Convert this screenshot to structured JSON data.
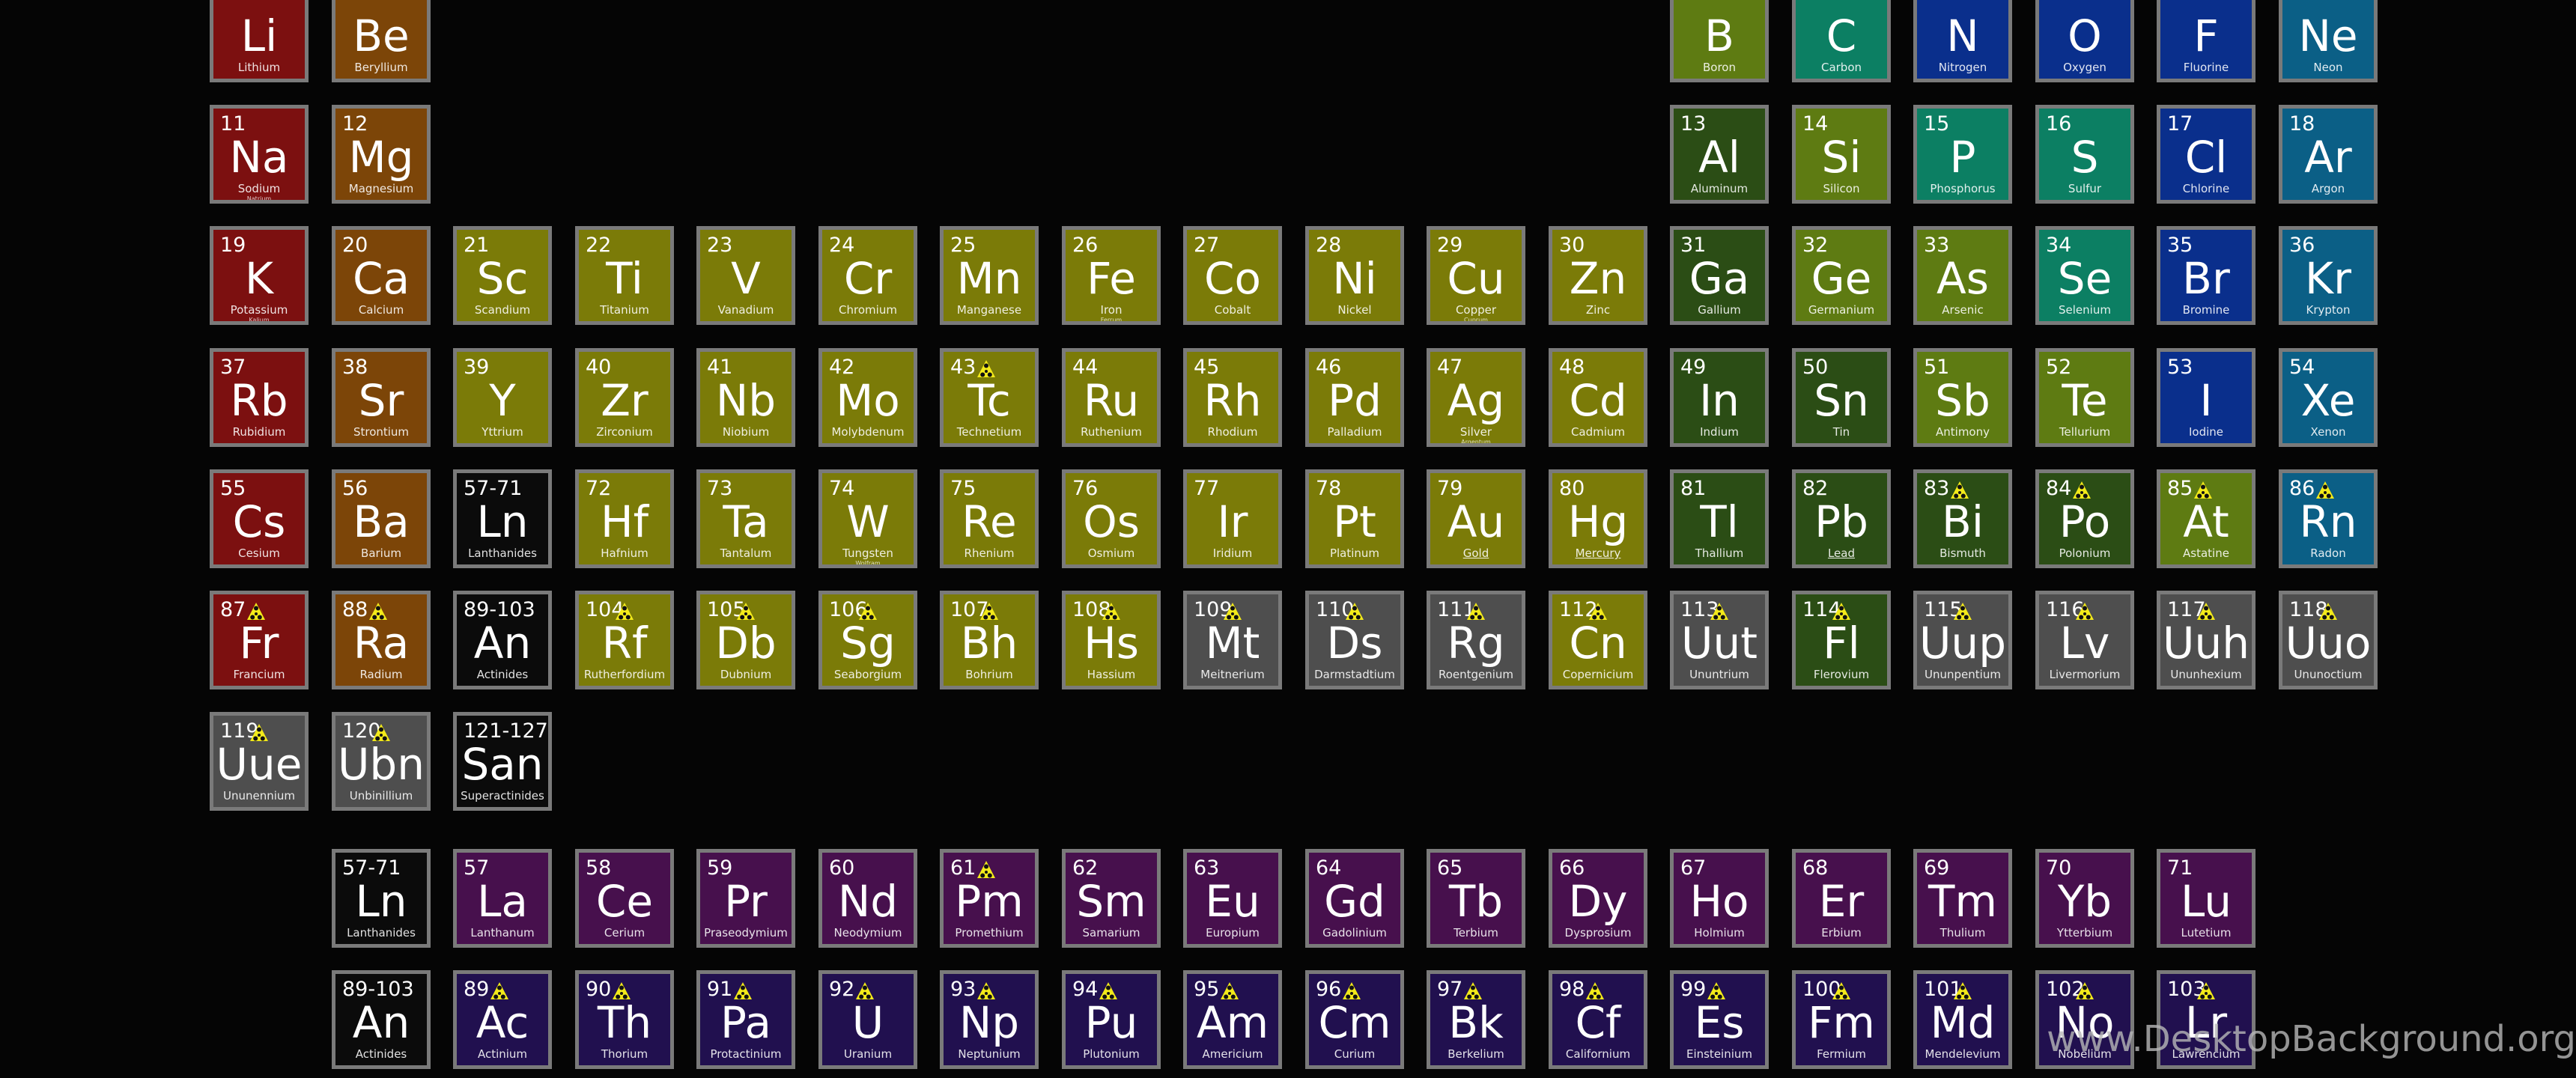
{
  "watermark": "www.DesktopBackground.org",
  "colors": {
    "alkali": "#7c1010",
    "alkaline": "#7c4508",
    "transition": "#7b7b08",
    "post": "#2b4d15",
    "metalloid": "#5e7b12",
    "nonmetal": "#0c7f63",
    "halogen": "#0a2f8c",
    "noble": "#0b5f86",
    "unknown": "#4e4e4e",
    "group": "#0b0b0b",
    "lanthanide": "#47104d",
    "actinide": "#21104f",
    "radioactive_icon": "#f3ea1a"
  },
  "main_table": [
    {
      "n": "",
      "s": "Li",
      "name": "Lithium",
      "cat": "alkali",
      "row": 0,
      "col": 0
    },
    {
      "n": "",
      "s": "Be",
      "name": "Beryllium",
      "cat": "alkaline",
      "row": 0,
      "col": 1
    },
    {
      "n": "",
      "s": "B",
      "name": "Boron",
      "cat": "metalloid",
      "row": 0,
      "col": 12
    },
    {
      "n": "",
      "s": "C",
      "name": "Carbon",
      "cat": "nonmetal",
      "row": 0,
      "col": 13
    },
    {
      "n": "",
      "s": "N",
      "name": "Nitrogen",
      "cat": "halogen",
      "row": 0,
      "col": 14
    },
    {
      "n": "",
      "s": "O",
      "name": "Oxygen",
      "cat": "halogen",
      "row": 0,
      "col": 15
    },
    {
      "n": "",
      "s": "F",
      "name": "Fluorine",
      "cat": "halogen",
      "row": 0,
      "col": 16
    },
    {
      "n": "",
      "s": "Ne",
      "name": "Neon",
      "cat": "noble",
      "row": 0,
      "col": 17
    },
    {
      "n": "11",
      "s": "Na",
      "name": "Sodium",
      "alt": "Natrium",
      "cat": "alkali",
      "row": 1,
      "col": 0
    },
    {
      "n": "12",
      "s": "Mg",
      "name": "Magnesium",
      "cat": "alkaline",
      "row": 1,
      "col": 1
    },
    {
      "n": "13",
      "s": "Al",
      "name": "Aluminum",
      "cat": "post",
      "row": 1,
      "col": 12
    },
    {
      "n": "14",
      "s": "Si",
      "name": "Silicon",
      "cat": "metalloid",
      "row": 1,
      "col": 13
    },
    {
      "n": "15",
      "s": "P",
      "name": "Phosphorus",
      "cat": "nonmetal",
      "row": 1,
      "col": 14
    },
    {
      "n": "16",
      "s": "S",
      "name": "Sulfur",
      "cat": "nonmetal",
      "row": 1,
      "col": 15
    },
    {
      "n": "17",
      "s": "Cl",
      "name": "Chlorine",
      "cat": "halogen",
      "row": 1,
      "col": 16
    },
    {
      "n": "18",
      "s": "Ar",
      "name": "Argon",
      "cat": "noble",
      "row": 1,
      "col": 17
    },
    {
      "n": "19",
      "s": "K",
      "name": "Potassium",
      "alt": "Kalium",
      "cat": "alkali",
      "row": 2,
      "col": 0
    },
    {
      "n": "20",
      "s": "Ca",
      "name": "Calcium",
      "cat": "alkaline",
      "row": 2,
      "col": 1
    },
    {
      "n": "21",
      "s": "Sc",
      "name": "Scandium",
      "cat": "transition",
      "row": 2,
      "col": 2
    },
    {
      "n": "22",
      "s": "Ti",
      "name": "Titanium",
      "cat": "transition",
      "row": 2,
      "col": 3
    },
    {
      "n": "23",
      "s": "V",
      "name": "Vanadium",
      "cat": "transition",
      "row": 2,
      "col": 4
    },
    {
      "n": "24",
      "s": "Cr",
      "name": "Chromium",
      "cat": "transition",
      "row": 2,
      "col": 5
    },
    {
      "n": "25",
      "s": "Mn",
      "name": "Manganese",
      "cat": "transition",
      "row": 2,
      "col": 6
    },
    {
      "n": "26",
      "s": "Fe",
      "name": "Iron",
      "alt": "Ferrum",
      "cat": "transition",
      "row": 2,
      "col": 7
    },
    {
      "n": "27",
      "s": "Co",
      "name": "Cobalt",
      "cat": "transition",
      "row": 2,
      "col": 8
    },
    {
      "n": "28",
      "s": "Ni",
      "name": "Nickel",
      "cat": "transition",
      "row": 2,
      "col": 9
    },
    {
      "n": "29",
      "s": "Cu",
      "name": "Copper",
      "alt": "Cuprum",
      "cat": "transition",
      "row": 2,
      "col": 10
    },
    {
      "n": "30",
      "s": "Zn",
      "name": "Zinc",
      "cat": "transition",
      "row": 2,
      "col": 11
    },
    {
      "n": "31",
      "s": "Ga",
      "name": "Gallium",
      "cat": "post",
      "row": 2,
      "col": 12
    },
    {
      "n": "32",
      "s": "Ge",
      "name": "Germanium",
      "cat": "metalloid",
      "row": 2,
      "col": 13
    },
    {
      "n": "33",
      "s": "As",
      "name": "Arsenic",
      "cat": "metalloid",
      "row": 2,
      "col": 14
    },
    {
      "n": "34",
      "s": "Se",
      "name": "Selenium",
      "cat": "nonmetal",
      "row": 2,
      "col": 15
    },
    {
      "n": "35",
      "s": "Br",
      "name": "Bromine",
      "cat": "halogen",
      "row": 2,
      "col": 16
    },
    {
      "n": "36",
      "s": "Kr",
      "name": "Krypton",
      "cat": "noble",
      "row": 2,
      "col": 17
    },
    {
      "n": "37",
      "s": "Rb",
      "name": "Rubidium",
      "cat": "alkali",
      "row": 3,
      "col": 0
    },
    {
      "n": "38",
      "s": "Sr",
      "name": "Strontium",
      "cat": "alkaline",
      "row": 3,
      "col": 1
    },
    {
      "n": "39",
      "s": "Y",
      "name": "Yttrium",
      "cat": "transition",
      "row": 3,
      "col": 2
    },
    {
      "n": "40",
      "s": "Zr",
      "name": "Zirconium",
      "cat": "transition",
      "row": 3,
      "col": 3
    },
    {
      "n": "41",
      "s": "Nb",
      "name": "Niobium",
      "cat": "transition",
      "row": 3,
      "col": 4
    },
    {
      "n": "42",
      "s": "Mo",
      "name": "Molybdenum",
      "cat": "transition",
      "row": 3,
      "col": 5
    },
    {
      "n": "43",
      "s": "Tc",
      "name": "Technetium",
      "cat": "transition",
      "row": 3,
      "col": 6,
      "rad": true
    },
    {
      "n": "44",
      "s": "Ru",
      "name": "Ruthenium",
      "cat": "transition",
      "row": 3,
      "col": 7
    },
    {
      "n": "45",
      "s": "Rh",
      "name": "Rhodium",
      "cat": "transition",
      "row": 3,
      "col": 8
    },
    {
      "n": "46",
      "s": "Pd",
      "name": "Palladium",
      "cat": "transition",
      "row": 3,
      "col": 9
    },
    {
      "n": "47",
      "s": "Ag",
      "name": "Silver",
      "alt": "Argentum",
      "cat": "transition",
      "row": 3,
      "col": 10
    },
    {
      "n": "48",
      "s": "Cd",
      "name": "Cadmium",
      "cat": "transition",
      "row": 3,
      "col": 11
    },
    {
      "n": "49",
      "s": "In",
      "name": "Indium",
      "cat": "post",
      "row": 3,
      "col": 12
    },
    {
      "n": "50",
      "s": "Sn",
      "name": "Tin",
      "cat": "post",
      "row": 3,
      "col": 13
    },
    {
      "n": "51",
      "s": "Sb",
      "name": "Antimony",
      "cat": "metalloid",
      "row": 3,
      "col": 14
    },
    {
      "n": "52",
      "s": "Te",
      "name": "Tellurium",
      "cat": "metalloid",
      "row": 3,
      "col": 15
    },
    {
      "n": "53",
      "s": "I",
      "name": "Iodine",
      "cat": "halogen",
      "row": 3,
      "col": 16
    },
    {
      "n": "54",
      "s": "Xe",
      "name": "Xenon",
      "cat": "noble",
      "row": 3,
      "col": 17
    },
    {
      "n": "55",
      "s": "Cs",
      "name": "Cesium",
      "cat": "alkali",
      "row": 4,
      "col": 0
    },
    {
      "n": "56",
      "s": "Ba",
      "name": "Barium",
      "cat": "alkaline",
      "row": 4,
      "col": 1
    },
    {
      "n": "57-71",
      "s": "Ln",
      "name": "Lanthanides",
      "cat": "group",
      "row": 4,
      "col": 2
    },
    {
      "n": "72",
      "s": "Hf",
      "name": "Hafnium",
      "cat": "transition",
      "row": 4,
      "col": 3
    },
    {
      "n": "73",
      "s": "Ta",
      "name": "Tantalum",
      "cat": "transition",
      "row": 4,
      "col": 4
    },
    {
      "n": "74",
      "s": "W",
      "name": "Tungsten",
      "alt": "Wolfram",
      "cat": "transition",
      "row": 4,
      "col": 5
    },
    {
      "n": "75",
      "s": "Re",
      "name": "Rhenium",
      "cat": "transition",
      "row": 4,
      "col": 6
    },
    {
      "n": "76",
      "s": "Os",
      "name": "Osmium",
      "cat": "transition",
      "row": 4,
      "col": 7
    },
    {
      "n": "77",
      "s": "Ir",
      "name": "Iridium",
      "cat": "transition",
      "row": 4,
      "col": 8
    },
    {
      "n": "78",
      "s": "Pt",
      "name": "Platinum",
      "cat": "transition",
      "row": 4,
      "col": 9
    },
    {
      "n": "79",
      "s": "Au",
      "name": "Gold",
      "cat": "transition",
      "row": 4,
      "col": 10,
      "underline": true
    },
    {
      "n": "80",
      "s": "Hg",
      "name": "Mercury",
      "cat": "transition",
      "row": 4,
      "col": 11,
      "underline": true
    },
    {
      "n": "81",
      "s": "Tl",
      "name": "Thallium",
      "cat": "post",
      "row": 4,
      "col": 12
    },
    {
      "n": "82",
      "s": "Pb",
      "name": "Lead",
      "cat": "post",
      "row": 4,
      "col": 13,
      "underline": true
    },
    {
      "n": "83",
      "s": "Bi",
      "name": "Bismuth",
      "cat": "post",
      "row": 4,
      "col": 14,
      "rad": true
    },
    {
      "n": "84",
      "s": "Po",
      "name": "Polonium",
      "cat": "post",
      "row": 4,
      "col": 15,
      "rad": true
    },
    {
      "n": "85",
      "s": "At",
      "name": "Astatine",
      "cat": "metalloid",
      "row": 4,
      "col": 16,
      "rad": true
    },
    {
      "n": "86",
      "s": "Rn",
      "name": "Radon",
      "cat": "noble",
      "row": 4,
      "col": 17,
      "rad": true
    },
    {
      "n": "87",
      "s": "Fr",
      "name": "Francium",
      "cat": "alkali",
      "row": 5,
      "col": 0,
      "rad": true
    },
    {
      "n": "88",
      "s": "Ra",
      "name": "Radium",
      "cat": "alkaline",
      "row": 5,
      "col": 1,
      "rad": true
    },
    {
      "n": "89-103",
      "s": "An",
      "name": "Actinides",
      "cat": "group",
      "row": 5,
      "col": 2
    },
    {
      "n": "104",
      "s": "Rf",
      "name": "Rutherfordium",
      "cat": "transition",
      "row": 5,
      "col": 3,
      "rad": true
    },
    {
      "n": "105",
      "s": "Db",
      "name": "Dubnium",
      "cat": "transition",
      "row": 5,
      "col": 4,
      "rad": true
    },
    {
      "n": "106",
      "s": "Sg",
      "name": "Seaborgium",
      "cat": "transition",
      "row": 5,
      "col": 5,
      "rad": true
    },
    {
      "n": "107",
      "s": "Bh",
      "name": "Bohrium",
      "cat": "transition",
      "row": 5,
      "col": 6,
      "rad": true
    },
    {
      "n": "108",
      "s": "Hs",
      "name": "Hassium",
      "cat": "transition",
      "row": 5,
      "col": 7,
      "rad": true
    },
    {
      "n": "109",
      "s": "Mt",
      "name": "Meitnerium",
      "cat": "unknown",
      "row": 5,
      "col": 8,
      "rad": true
    },
    {
      "n": "110",
      "s": "Ds",
      "name": "Darmstadtium",
      "cat": "unknown",
      "row": 5,
      "col": 9,
      "rad": true
    },
    {
      "n": "111",
      "s": "Rg",
      "name": "Roentgenium",
      "cat": "unknown",
      "row": 5,
      "col": 10,
      "rad": true
    },
    {
      "n": "112",
      "s": "Cn",
      "name": "Copernicium",
      "cat": "transition",
      "row": 5,
      "col": 11,
      "rad": true
    },
    {
      "n": "113",
      "s": "Uut",
      "name": "Ununtrium",
      "cat": "unknown",
      "row": 5,
      "col": 12,
      "rad": true
    },
    {
      "n": "114",
      "s": "Fl",
      "name": "Flerovium",
      "cat": "post",
      "row": 5,
      "col": 13,
      "rad": true
    },
    {
      "n": "115",
      "s": "Uup",
      "name": "Ununpentium",
      "cat": "unknown",
      "row": 5,
      "col": 14,
      "rad": true
    },
    {
      "n": "116",
      "s": "Lv",
      "name": "Livermorium",
      "cat": "unknown",
      "row": 5,
      "col": 15,
      "rad": true
    },
    {
      "n": "117",
      "s": "Uuh",
      "name": "Ununhexium",
      "cat": "unknown",
      "row": 5,
      "col": 16,
      "rad": true
    },
    {
      "n": "118",
      "s": "Uuo",
      "name": "Ununoctium",
      "cat": "unknown",
      "row": 5,
      "col": 17,
      "rad": true
    },
    {
      "n": "119",
      "s": "Uue",
      "name": "Ununennium",
      "cat": "unknown",
      "row": 6,
      "col": 0,
      "rad": true
    },
    {
      "n": "120",
      "s": "Ubn",
      "name": "Unbinillium",
      "cat": "unknown",
      "row": 6,
      "col": 1,
      "rad": true
    },
    {
      "n": "121-127",
      "s": "San",
      "name": "Superactinides",
      "cat": "group",
      "row": 6,
      "col": 2
    }
  ],
  "lanthanides": [
    {
      "n": "57-71",
      "s": "Ln",
      "name": "Lanthanides",
      "cat": "group",
      "col": 1
    },
    {
      "n": "57",
      "s": "La",
      "name": "Lanthanum",
      "cat": "lanthanide",
      "col": 2
    },
    {
      "n": "58",
      "s": "Ce",
      "name": "Cerium",
      "cat": "lanthanide",
      "col": 3
    },
    {
      "n": "59",
      "s": "Pr",
      "name": "Praseodymium",
      "cat": "lanthanide",
      "col": 4
    },
    {
      "n": "60",
      "s": "Nd",
      "name": "Neodymium",
      "cat": "lanthanide",
      "col": 5
    },
    {
      "n": "61",
      "s": "Pm",
      "name": "Promethium",
      "cat": "lanthanide",
      "col": 6,
      "rad": true
    },
    {
      "n": "62",
      "s": "Sm",
      "name": "Samarium",
      "cat": "lanthanide",
      "col": 7
    },
    {
      "n": "63",
      "s": "Eu",
      "name": "Europium",
      "cat": "lanthanide",
      "col": 8
    },
    {
      "n": "64",
      "s": "Gd",
      "name": "Gadolinium",
      "cat": "lanthanide",
      "col": 9
    },
    {
      "n": "65",
      "s": "Tb",
      "name": "Terbium",
      "cat": "lanthanide",
      "col": 10
    },
    {
      "n": "66",
      "s": "Dy",
      "name": "Dysprosium",
      "cat": "lanthanide",
      "col": 11
    },
    {
      "n": "67",
      "s": "Ho",
      "name": "Holmium",
      "cat": "lanthanide",
      "col": 12
    },
    {
      "n": "68",
      "s": "Er",
      "name": "Erbium",
      "cat": "lanthanide",
      "col": 13
    },
    {
      "n": "69",
      "s": "Tm",
      "name": "Thulium",
      "cat": "lanthanide",
      "col": 14
    },
    {
      "n": "70",
      "s": "Yb",
      "name": "Ytterbium",
      "cat": "lanthanide",
      "col": 15
    },
    {
      "n": "71",
      "s": "Lu",
      "name": "Lutetium",
      "cat": "lanthanide",
      "col": 16
    }
  ],
  "actinides": [
    {
      "n": "89-103",
      "s": "An",
      "name": "Actinides",
      "cat": "group",
      "col": 1
    },
    {
      "n": "89",
      "s": "Ac",
      "name": "Actinium",
      "cat": "actinide",
      "col": 2,
      "rad": true
    },
    {
      "n": "90",
      "s": "Th",
      "name": "Thorium",
      "cat": "actinide",
      "col": 3,
      "rad": true
    },
    {
      "n": "91",
      "s": "Pa",
      "name": "Protactinium",
      "cat": "actinide",
      "col": 4,
      "rad": true
    },
    {
      "n": "92",
      "s": "U",
      "name": "Uranium",
      "cat": "actinide",
      "col": 5,
      "rad": true
    },
    {
      "n": "93",
      "s": "Np",
      "name": "Neptunium",
      "cat": "actinide",
      "col": 6,
      "rad": true
    },
    {
      "n": "94",
      "s": "Pu",
      "name": "Plutonium",
      "cat": "actinide",
      "col": 7,
      "rad": true
    },
    {
      "n": "95",
      "s": "Am",
      "name": "Americium",
      "cat": "actinide",
      "col": 8,
      "rad": true
    },
    {
      "n": "96",
      "s": "Cm",
      "name": "Curium",
      "cat": "actinide",
      "col": 9,
      "rad": true
    },
    {
      "n": "97",
      "s": "Bk",
      "name": "Berkelium",
      "cat": "actinide",
      "col": 10,
      "rad": true
    },
    {
      "n": "98",
      "s": "Cf",
      "name": "Californium",
      "cat": "actinide",
      "col": 11,
      "rad": true
    },
    {
      "n": "99",
      "s": "Es",
      "name": "Einsteinium",
      "cat": "actinide",
      "col": 12,
      "rad": true
    },
    {
      "n": "100",
      "s": "Fm",
      "name": "Fermium",
      "cat": "actinide",
      "col": 13,
      "rad": true
    },
    {
      "n": "101",
      "s": "Md",
      "name": "Mendelevium",
      "cat": "actinide",
      "col": 14,
      "rad": true
    },
    {
      "n": "102",
      "s": "No",
      "name": "Nobelium",
      "cat": "actinide",
      "col": 15,
      "rad": true
    },
    {
      "n": "103",
      "s": "Lr",
      "name": "Lawrencium",
      "cat": "actinide",
      "col": 16,
      "rad": true
    }
  ]
}
